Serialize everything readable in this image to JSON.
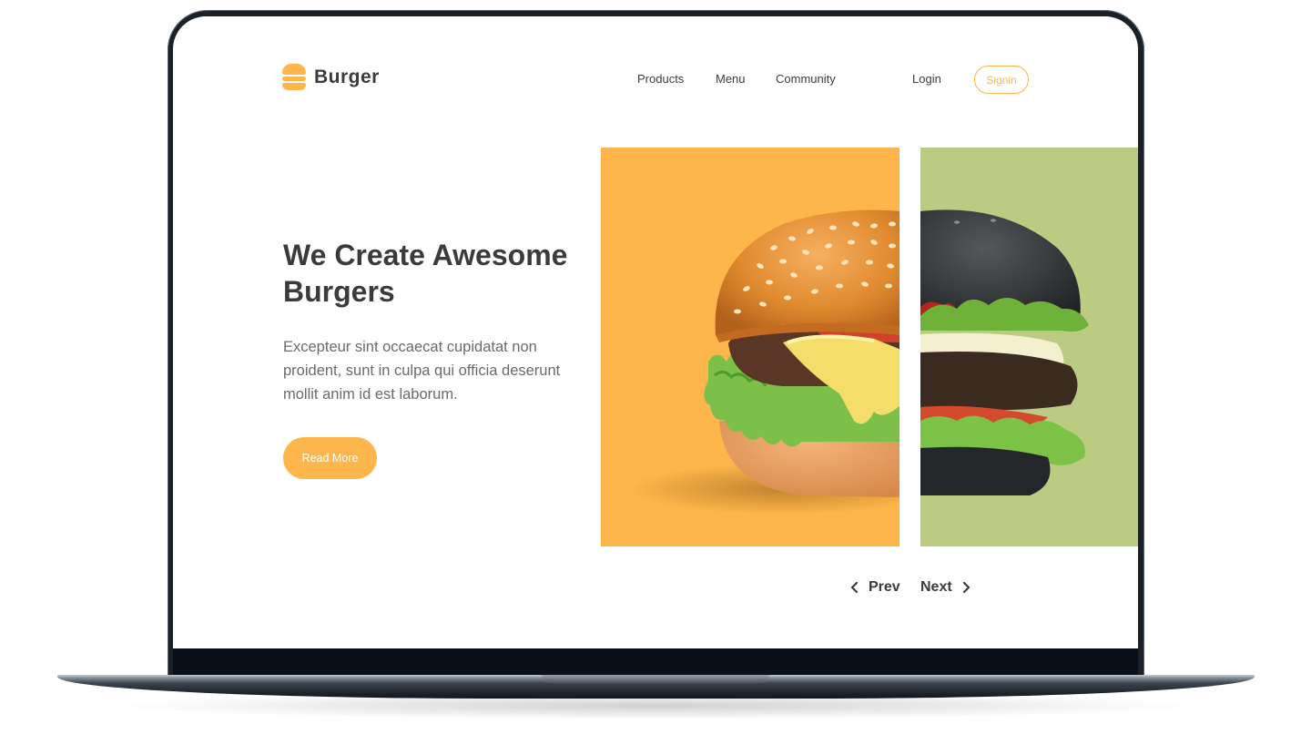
{
  "brand": {
    "name": "Burger",
    "accent": "#fdb64b",
    "slide2_color": "#bccb82"
  },
  "nav": {
    "products": "Products",
    "menu": "Menu",
    "community": "Community",
    "login": "Login",
    "signin": "Signin"
  },
  "hero": {
    "title": "We Create Awesome Burgers",
    "description": "Excepteur sint occaecat cupidatat non proident, sunt in culpa qui officia deserunt mollit anim id est laborum.",
    "cta": "Read More"
  },
  "slides": [
    {
      "subject": "sesame-bun-burger-image",
      "background": "#fdb64b"
    },
    {
      "subject": "black-bun-burger-image",
      "background": "#bccb82"
    }
  ],
  "pager": {
    "prev": "Prev",
    "next": "Next"
  },
  "icons": [
    "burger-logo-icon",
    "chevron-left-icon",
    "chevron-right-icon"
  ]
}
